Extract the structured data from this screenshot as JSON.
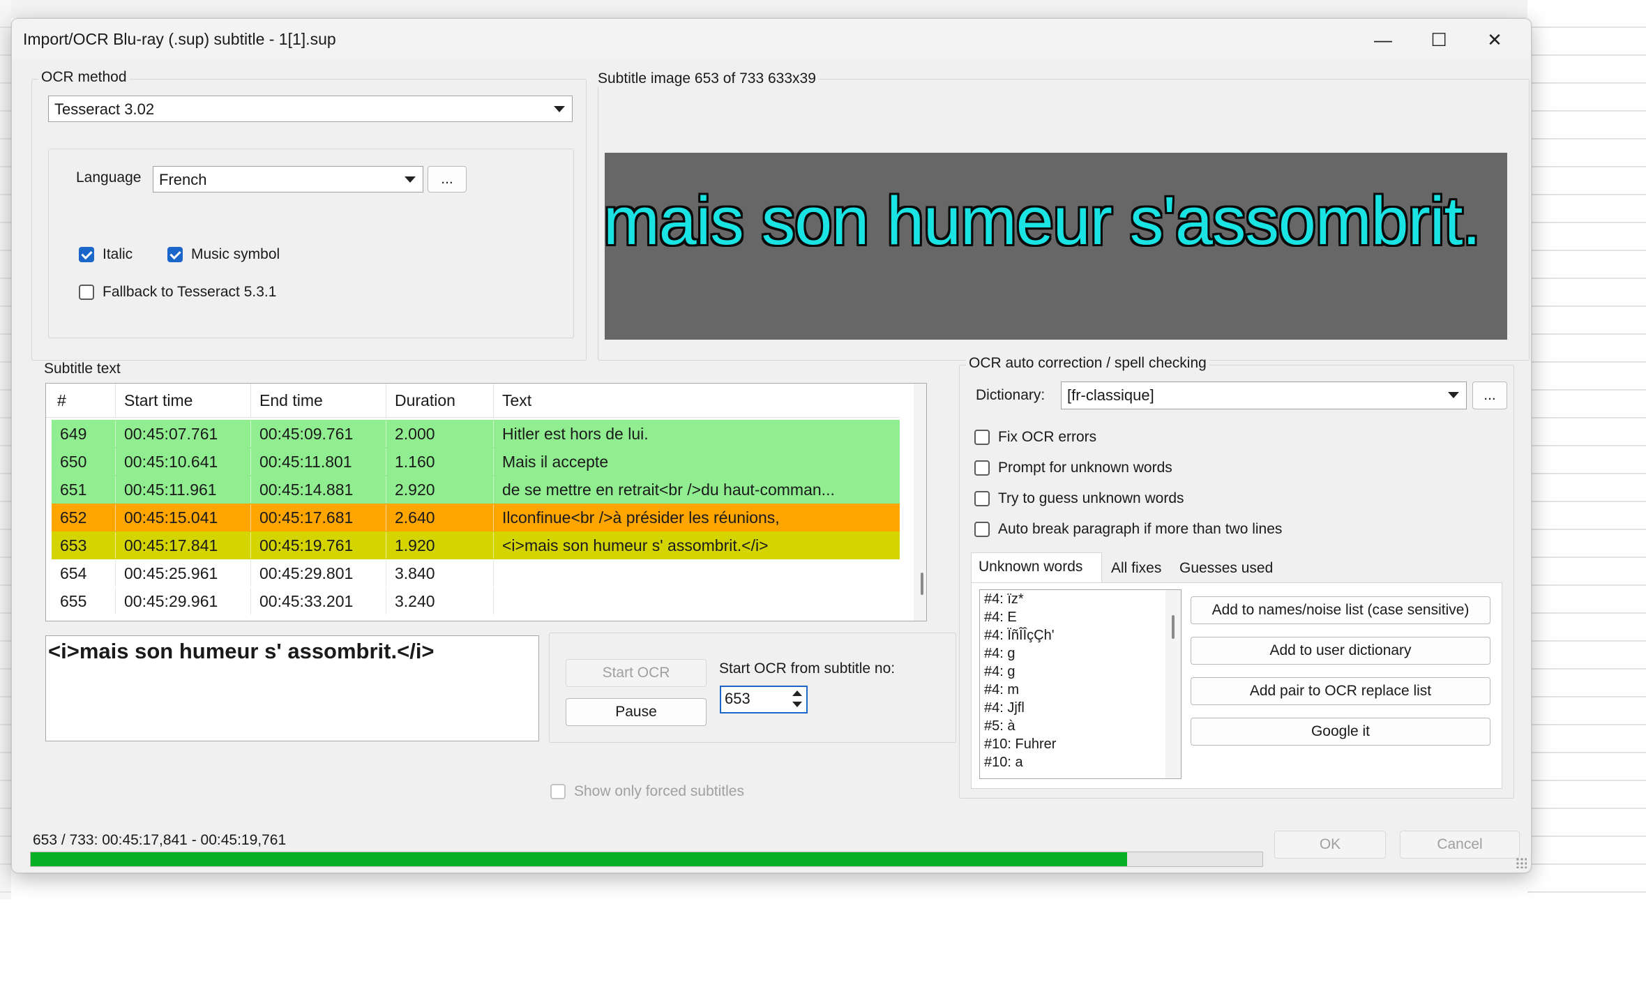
{
  "window": {
    "title": "Import/OCR Blu-ray (.sup) subtitle - 1[1].sup",
    "minimize_glyph": "—",
    "maximize_glyph": "☐",
    "close_glyph": "✕"
  },
  "ocr_method": {
    "group_label": "OCR method",
    "selected": "Tesseract 3.02",
    "language_label": "Language",
    "language_selected": "French",
    "language_more": "...",
    "italic_label": "Italic",
    "italic_checked": true,
    "music_label": "Music symbol",
    "music_checked": true,
    "fallback_label": "Fallback to Tesseract 5.3.1",
    "fallback_checked": false
  },
  "subtitle_image": {
    "group_label": "Subtitle image 653 of 733   633x39",
    "preview_text": "mais son humeur s'assombrit."
  },
  "subtitle_text": {
    "group_label": "Subtitle text",
    "columns": [
      "#",
      "Start time",
      "End time",
      "Duration",
      "Text"
    ],
    "rows": [
      {
        "num": "649",
        "start": "00:45:07.761",
        "end": "00:45:09.761",
        "duration": "2.000",
        "text": "Hitler est hors de lui.",
        "color": "#90ee90"
      },
      {
        "num": "650",
        "start": "00:45:10.641",
        "end": "00:45:11.801",
        "duration": "1.160",
        "text": "Mais il accepte",
        "color": "#90ee90"
      },
      {
        "num": "651",
        "start": "00:45:11.961",
        "end": "00:45:14.881",
        "duration": "2.920",
        "text": "de se mettre en retrait<br />du haut-comman...",
        "color": "#90ee90"
      },
      {
        "num": "652",
        "start": "00:45:15.041",
        "end": "00:45:17.681",
        "duration": "2.640",
        "text": "Ilconfinue<br />à présider les réunions,",
        "color": "#ffa500"
      },
      {
        "num": "653",
        "start": "00:45:17.841",
        "end": "00:45:19.761",
        "duration": "1.920",
        "text": "<i>mais son humeur s' assombrit.</i>",
        "color": "#d4d400"
      },
      {
        "num": "654",
        "start": "00:45:25.961",
        "end": "00:45:29.801",
        "duration": "3.840",
        "text": "",
        "color": "#ffffff"
      },
      {
        "num": "655",
        "start": "00:45:29.961",
        "end": "00:45:33.201",
        "duration": "3.240",
        "text": "",
        "color": "#ffffff"
      }
    ],
    "current_text": "<i>mais son humeur s' assombrit.</i>"
  },
  "ocr_controls": {
    "start_ocr": "Start OCR",
    "pause": "Pause",
    "start_from_label": "Start OCR from subtitle no:",
    "start_from_value": "653",
    "forced_label": "Show only forced subtitles"
  },
  "auto_correction": {
    "group_label": "OCR auto correction / spell checking",
    "dictionary_label": "Dictionary:",
    "dictionary_selected": "[fr-classique]",
    "dictionary_more": "...",
    "fix_ocr": "Fix OCR errors",
    "prompt_unknown": "Prompt for unknown words",
    "guess_unknown": "Try to guess unknown words",
    "auto_break": "Auto break paragraph if more than two lines",
    "tabs": [
      "Unknown words",
      "All fixes",
      "Guesses used"
    ],
    "unknown_words": [
      "#4: ïz*",
      "#4: E",
      "#4: ÏñÎÎçÇh'",
      "#4: g",
      "#4: g",
      "#4: m",
      "#4: Jjfl",
      "#5: à",
      "#10: Fuhrer",
      "#10: a"
    ],
    "add_names": "Add to names/noise list (case sensitive)",
    "add_user_dict": "Add to user dictionary",
    "add_pair": "Add pair to OCR replace list",
    "google": "Google it"
  },
  "footer": {
    "status": "653 / 733: 00:45:17,841 - 00:45:19,761",
    "progress": 0.89,
    "ok": "OK",
    "cancel": "Cancel"
  },
  "colors": {
    "progress": "#06b025",
    "preview_bg": "#676767",
    "preview_text": "#19e3e3",
    "checkbox": "#1b67c9"
  }
}
